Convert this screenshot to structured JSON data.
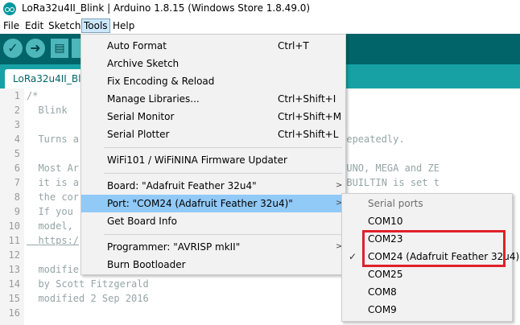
{
  "window": {
    "title": "LoRa32u4II_Blink | Arduino 1.8.15 (Windows Store 1.8.49.0)"
  },
  "menubar": {
    "items": [
      "File",
      "Edit",
      "Sketch",
      "Tools",
      "Help"
    ]
  },
  "tab": {
    "label": "LoRa32u4II_Blink"
  },
  "editor": {
    "lines": [
      {
        "n": "1",
        "text": "/*"
      },
      {
        "n": "2",
        "text": "  Blink"
      },
      {
        "n": "3",
        "text": ""
      },
      {
        "n": "4",
        "text": "  Turns a                                     second, repeatedly."
      },
      {
        "n": "5",
        "text": ""
      },
      {
        "n": "6",
        "text": "  Most Ar                                   ol. On the UNO, MEGA and ZE"
      },
      {
        "n": "7",
        "text": "  it is a                                   pin 6. LED_BUILTIN is set t"
      },
      {
        "n": "8",
        "text": "  the cor"
      },
      {
        "n": "9",
        "text": "  If you"
      },
      {
        "n": "10",
        "text": "  model,"
      },
      {
        "n": "11",
        "text": "  https:/"
      },
      {
        "n": "12",
        "text": ""
      },
      {
        "n": "13",
        "text": "  modifie"
      },
      {
        "n": "14",
        "text": "  by Scott Fitzgerald"
      },
      {
        "n": "15",
        "text": "  modified 2 Sep 2016"
      },
      {
        "n": "16",
        "text": ""
      }
    ]
  },
  "tools_menu": {
    "auto_format": {
      "label": "Auto Format",
      "shortcut": "Ctrl+T"
    },
    "archive_sketch": {
      "label": "Archive Sketch"
    },
    "fix_encoding": {
      "label": "Fix Encoding & Reload"
    },
    "manage_libraries": {
      "label": "Manage Libraries...",
      "shortcut": "Ctrl+Shift+I"
    },
    "serial_monitor": {
      "label": "Serial Monitor",
      "shortcut": "Ctrl+Shift+M"
    },
    "serial_plotter": {
      "label": "Serial Plotter",
      "shortcut": "Ctrl+Shift+L"
    },
    "wifi_updater": {
      "label": "WiFi101 / WiFiNINA Firmware Updater"
    },
    "board": {
      "label": "Board: \"Adafruit Feather 32u4\""
    },
    "port": {
      "label": "Port: \"COM24 (Adafruit Feather 32u4)\""
    },
    "board_info": {
      "label": "Get Board Info"
    },
    "programmer": {
      "label": "Programmer: \"AVRISP mkII\""
    },
    "burn_bootloader": {
      "label": "Burn Bootloader"
    }
  },
  "port_submenu": {
    "header": "Serial ports",
    "ports": [
      "COM10",
      "COM23",
      "COM24 (Adafruit Feather 32u4)",
      "COM25",
      "COM8",
      "COM9"
    ],
    "selected": "COM24 (Adafruit Feather 32u4)"
  },
  "colors": {
    "teal_dark": "#006468",
    "teal_tab": "#17a1a5",
    "menu_highlight": "#91c9f7",
    "annotation": "#e0202a"
  }
}
